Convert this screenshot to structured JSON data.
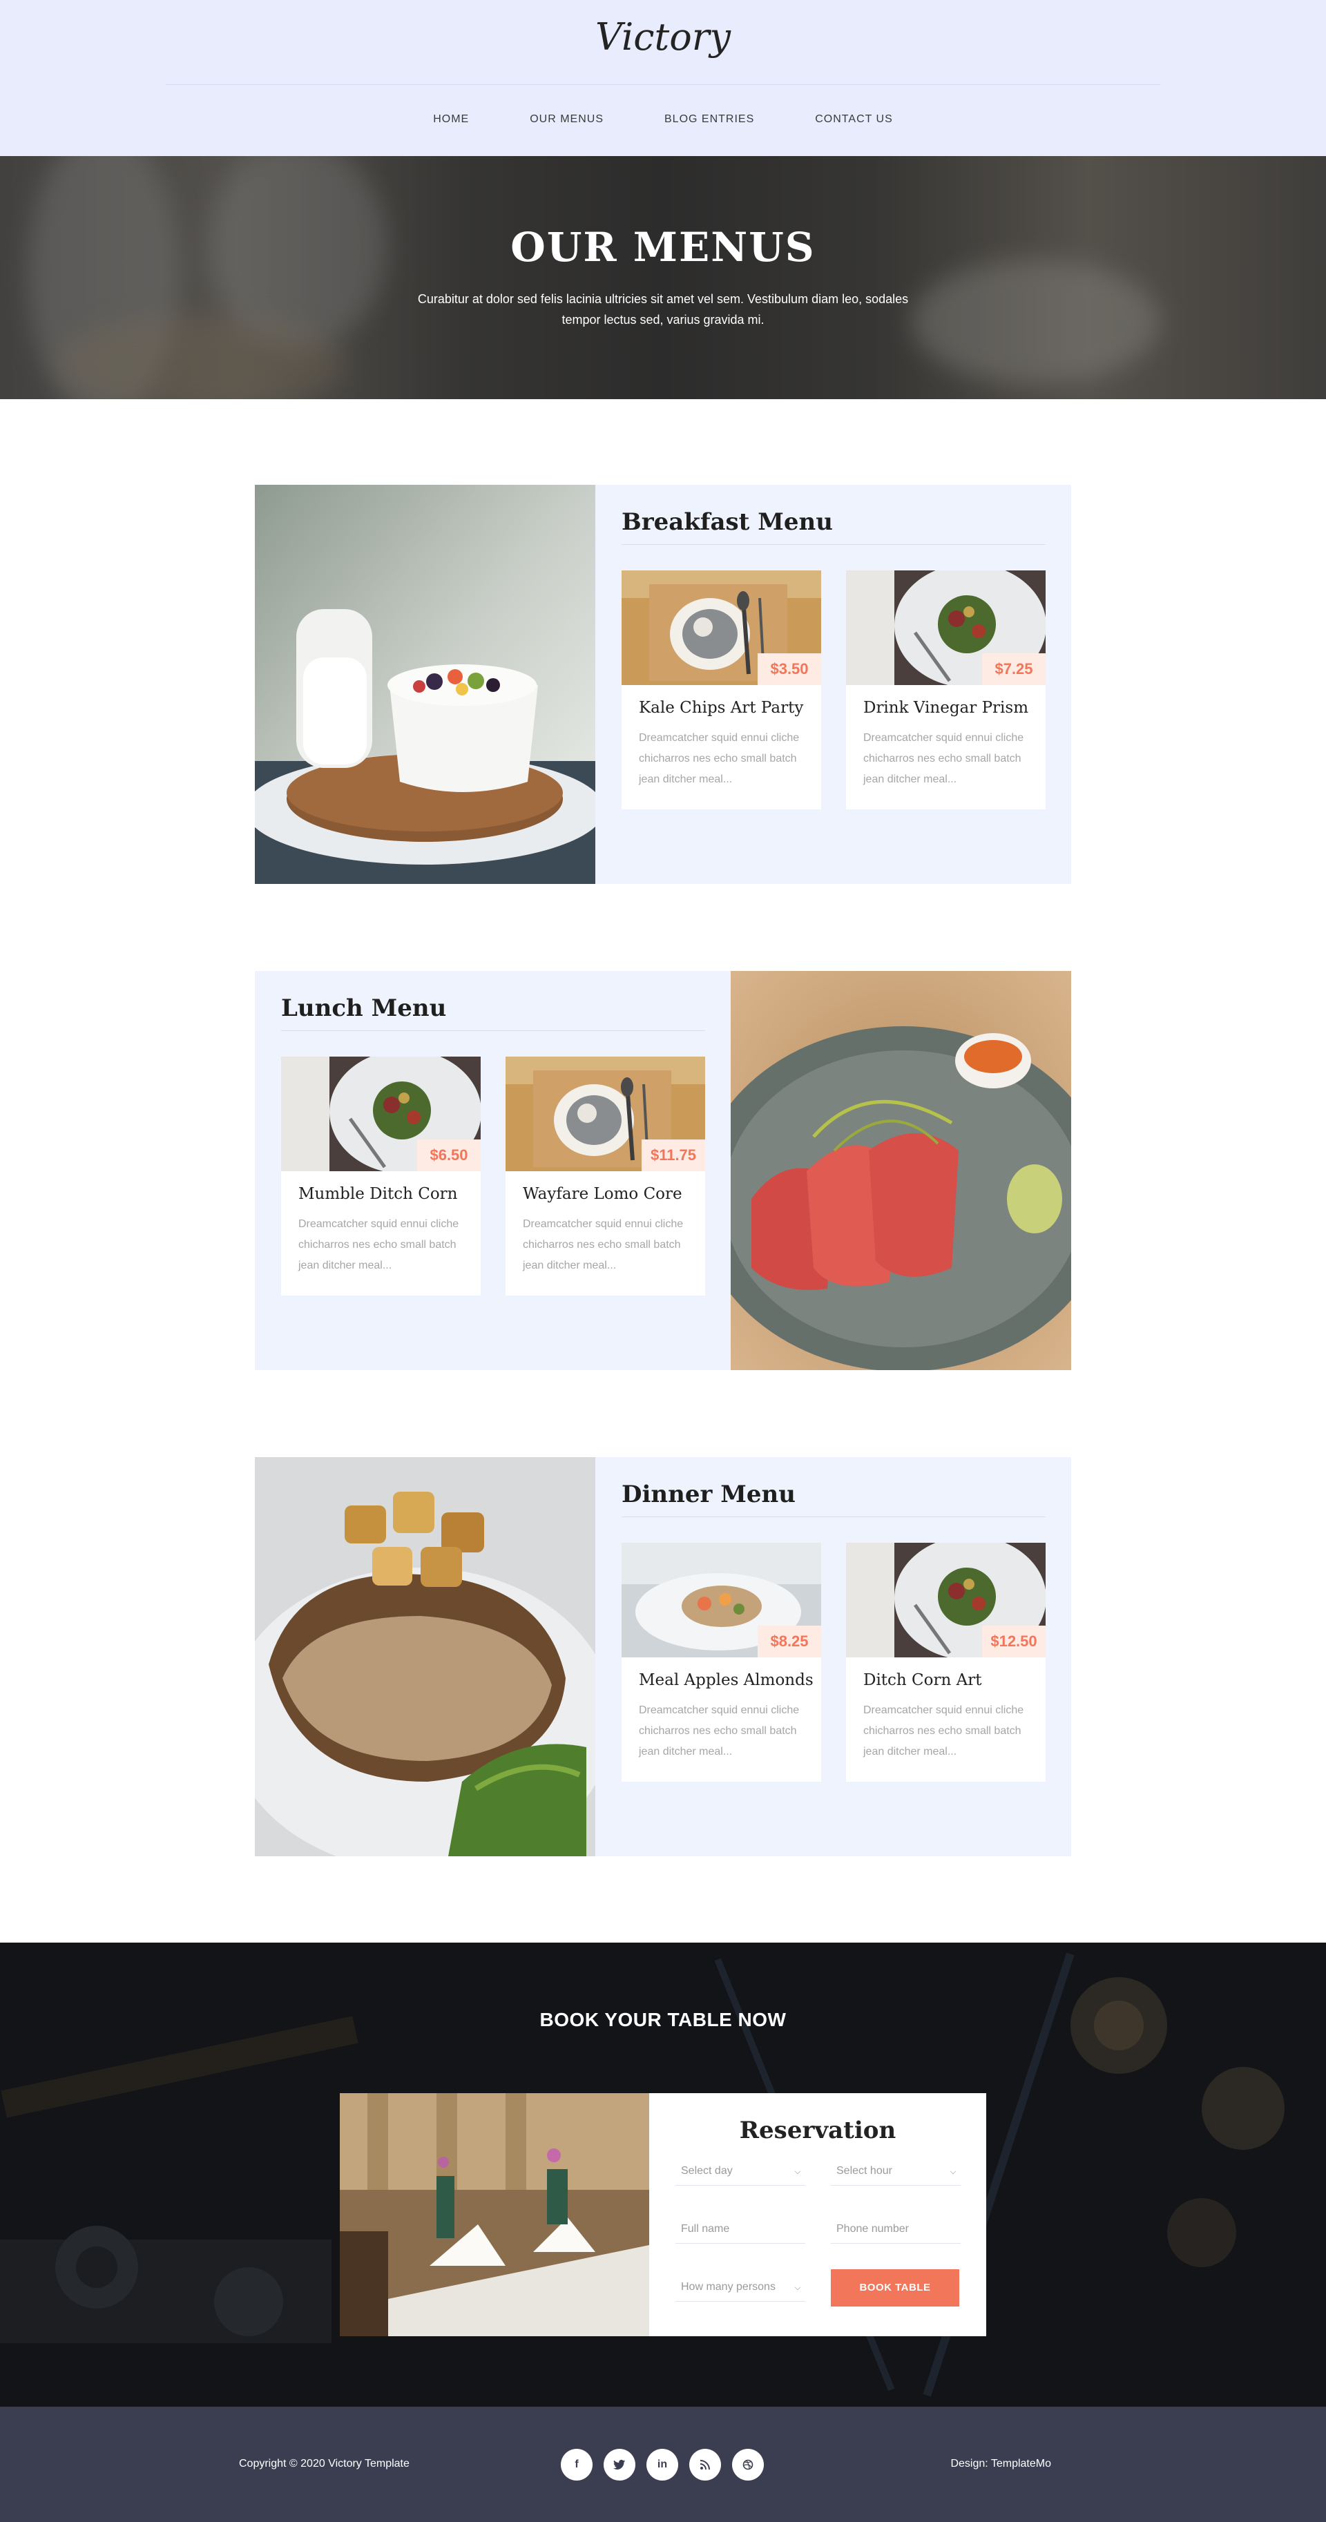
{
  "header": {
    "logo": "Victory",
    "nav": [
      "HOME",
      "OUR MENUS",
      "BLOG ENTRIES",
      "CONTACT US"
    ]
  },
  "hero": {
    "title": "OUR MENUS",
    "subtitle": "Curabitur at dolor sed felis lacinia ultricies sit amet vel sem. Vestibulum diam leo, sodales tempor lectus sed, varius gravida mi."
  },
  "menus": [
    {
      "heading": "Breakfast Menu",
      "items": [
        {
          "price": "$3.50",
          "title": "Kale Chips Art Party",
          "desc": "Dreamcatcher squid ennui cliche chicharros nes echo small batch jean ditcher meal..."
        },
        {
          "price": "$7.25",
          "title": "Drink Vinegar Prism",
          "desc": "Dreamcatcher squid ennui cliche chicharros nes echo small batch jean ditcher meal..."
        }
      ]
    },
    {
      "heading": "Lunch Menu",
      "items": [
        {
          "price": "$6.50",
          "title": "Mumble Ditch Corn",
          "desc": "Dreamcatcher squid ennui cliche chicharros nes echo small batch jean ditcher meal..."
        },
        {
          "price": "$11.75",
          "title": "Wayfare Lomo Core",
          "desc": "Dreamcatcher squid ennui cliche chicharros nes echo small batch jean ditcher meal..."
        }
      ]
    },
    {
      "heading": "Dinner Menu",
      "items": [
        {
          "price": "$8.25",
          "title": "Meal Apples Almonds",
          "desc": "Dreamcatcher squid ennui cliche chicharros nes echo small batch jean ditcher meal..."
        },
        {
          "price": "$12.50",
          "title": "Ditch Corn Art",
          "desc": "Dreamcatcher squid ennui cliche chicharros nes echo small batch jean ditcher meal..."
        }
      ]
    }
  ],
  "booking": {
    "title": "BOOK YOUR TABLE NOW",
    "form_title": "Reservation",
    "select_day": "Select day",
    "select_hour": "Select hour",
    "full_name": "Full name",
    "phone": "Phone number",
    "persons": "How many persons",
    "button": "BOOK TABLE"
  },
  "footer": {
    "copyright": "Copyright © 2020 Victory Template",
    "design": "Design: TemplateMo",
    "socials": [
      "facebook-icon",
      "twitter-icon",
      "linkedin-icon",
      "rss-icon",
      "dribbble-icon"
    ]
  },
  "colors": {
    "accent": "#f2765a",
    "header_bg": "#e8ecfd",
    "menu_bg": "#eff3fd",
    "footer_bg": "#3a3e50"
  }
}
